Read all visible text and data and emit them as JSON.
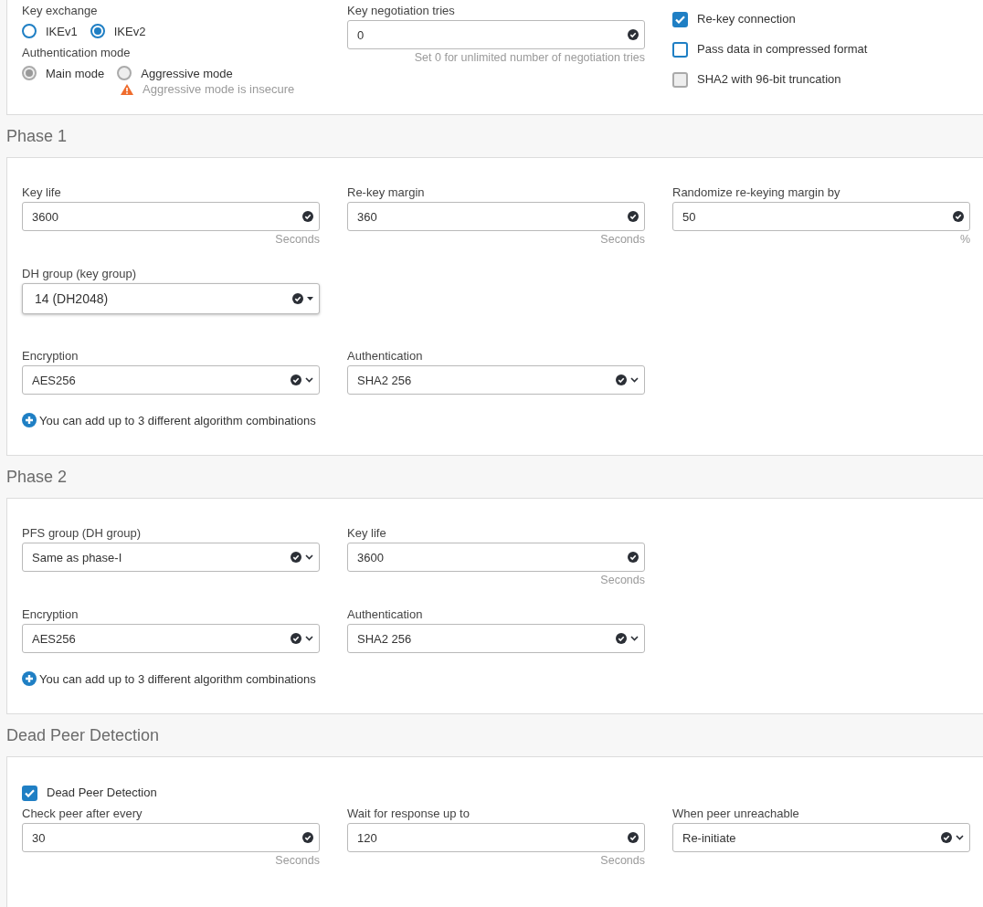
{
  "sections": [
    {
      "items": [
        {
          "kind": "row",
          "cells": [
            {
              "kind": "radios",
              "groups": [
                {
                  "label": "Key exchange",
                  "disabled": false,
                  "options": [
                    {
                      "label": "IKEv1",
                      "selected": false
                    },
                    {
                      "label": "IKEv2",
                      "selected": true
                    }
                  ]
                },
                {
                  "label": "Authentication mode",
                  "disabled": true,
                  "options": [
                    {
                      "label": "Main mode",
                      "selected": true
                    },
                    {
                      "label": "Aggressive mode",
                      "selected": false
                    }
                  ],
                  "warning": "Aggressive mode is insecure"
                }
              ]
            },
            {
              "kind": "input",
              "label": "Key negotiation tries",
              "value": "0",
              "hint": "Set 0 for unlimited number of negotiation tries"
            },
            {
              "kind": "checks",
              "items": [
                {
                  "label": "Re-key connection",
                  "checked": true,
                  "disabled": false
                },
                {
                  "label": "Pass data in compressed format",
                  "checked": false,
                  "disabled": false
                },
                {
                  "label": "SHA2 with 96-bit truncation",
                  "checked": false,
                  "disabled": true
                }
              ]
            }
          ]
        }
      ]
    },
    {
      "heading": "Phase 1",
      "items": [
        {
          "kind": "row",
          "cells": [
            {
              "kind": "input",
              "label": "Key life",
              "value": "3600",
              "hint": "Seconds"
            },
            {
              "kind": "input",
              "label": "Re-key margin",
              "value": "360",
              "hint": "Seconds"
            },
            {
              "kind": "input",
              "label": "Randomize re-keying margin by",
              "value": "50",
              "hint": "%"
            }
          ]
        },
        {
          "kind": "row",
          "cells": [
            {
              "kind": "dropdown",
              "label": "DH group (key group)",
              "value": "14 (DH2048)"
            }
          ]
        },
        {
          "kind": "row",
          "cells": [
            {
              "kind": "select",
              "label": "Encryption",
              "value": "AES256"
            },
            {
              "kind": "select",
              "label": "Authentication",
              "value": "SHA2 256"
            }
          ]
        },
        {
          "kind": "note",
          "text": "You can add up to 3 different algorithm combinations"
        }
      ]
    },
    {
      "heading": "Phase 2",
      "items": [
        {
          "kind": "row",
          "cells": [
            {
              "kind": "select",
              "label": "PFS group (DH group)",
              "value": "Same as phase-I"
            },
            {
              "kind": "input",
              "label": "Key life",
              "value": "3600",
              "hint": "Seconds"
            }
          ]
        },
        {
          "kind": "row",
          "cells": [
            {
              "kind": "select",
              "label": "Encryption",
              "value": "AES256"
            },
            {
              "kind": "select",
              "label": "Authentication",
              "value": "SHA2 256"
            }
          ]
        },
        {
          "kind": "note",
          "text": "You can add up to 3 different algorithm combinations"
        }
      ]
    },
    {
      "heading": "Dead Peer Detection",
      "items": [
        {
          "kind": "checkbox",
          "label": "Dead Peer Detection",
          "checked": true
        },
        {
          "kind": "row",
          "cells": [
            {
              "kind": "input",
              "label": "Check peer after every",
              "value": "30",
              "hint": "Seconds"
            },
            {
              "kind": "input",
              "label": "Wait for response up to",
              "value": "120",
              "hint": "Seconds"
            },
            {
              "kind": "select",
              "label": "When peer unreachable",
              "value": "Re-initiate"
            }
          ]
        }
      ]
    }
  ]
}
